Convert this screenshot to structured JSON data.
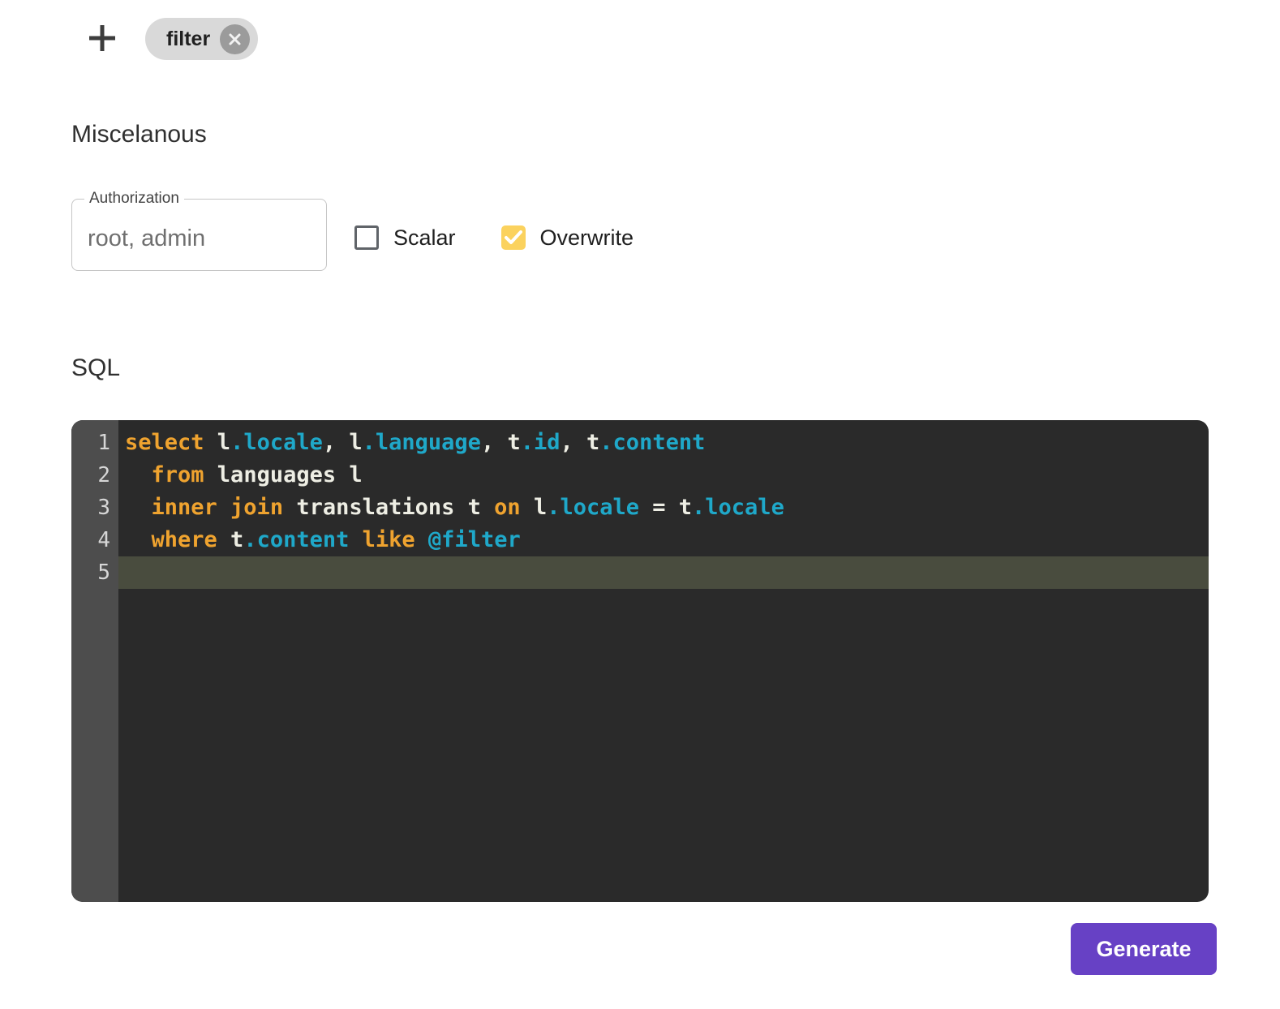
{
  "params_bar": {
    "add_icon": "plus-icon",
    "chips": [
      {
        "label": "filter"
      }
    ]
  },
  "misc_section": {
    "title": "Miscelanous",
    "authorization": {
      "label": "Authorization",
      "value": "root, admin"
    },
    "checkboxes": [
      {
        "label": "Scalar",
        "checked": false
      },
      {
        "label": "Overwrite",
        "checked": true
      }
    ]
  },
  "sql_section": {
    "title": "SQL",
    "editor": {
      "language": "sql",
      "active_line": 5,
      "lines": [
        {
          "number": 1,
          "tokens": [
            {
              "text": "select",
              "type": "keyword"
            },
            {
              "text": " l",
              "type": "plain"
            },
            {
              "text": ".locale",
              "type": "property"
            },
            {
              "text": ", l",
              "type": "plain"
            },
            {
              "text": ".language",
              "type": "property"
            },
            {
              "text": ", t",
              "type": "plain"
            },
            {
              "text": ".id",
              "type": "property"
            },
            {
              "text": ", t",
              "type": "plain"
            },
            {
              "text": ".content",
              "type": "property"
            }
          ]
        },
        {
          "number": 2,
          "tokens": [
            {
              "text": "  ",
              "type": "plain"
            },
            {
              "text": "from",
              "type": "keyword"
            },
            {
              "text": " languages l",
              "type": "plain"
            }
          ]
        },
        {
          "number": 3,
          "tokens": [
            {
              "text": "  ",
              "type": "plain"
            },
            {
              "text": "inner join",
              "type": "keyword"
            },
            {
              "text": " translations t ",
              "type": "plain"
            },
            {
              "text": "on",
              "type": "keyword"
            },
            {
              "text": " l",
              "type": "plain"
            },
            {
              "text": ".locale",
              "type": "property"
            },
            {
              "text": " = t",
              "type": "plain"
            },
            {
              "text": ".locale",
              "type": "property"
            }
          ]
        },
        {
          "number": 4,
          "tokens": [
            {
              "text": "  ",
              "type": "plain"
            },
            {
              "text": "where",
              "type": "keyword"
            },
            {
              "text": " t",
              "type": "plain"
            },
            {
              "text": ".content",
              "type": "property"
            },
            {
              "text": " ",
              "type": "plain"
            },
            {
              "text": "like",
              "type": "keyword"
            },
            {
              "text": " ",
              "type": "plain"
            },
            {
              "text": "@filter",
              "type": "property"
            }
          ]
        },
        {
          "number": 5,
          "tokens": []
        }
      ]
    }
  },
  "footer": {
    "generate_label": "Generate"
  },
  "colors": {
    "accent_purple": "#6741c5",
    "checkbox_amber": "#fbd25e",
    "chip_bg": "#d9d9d9",
    "chip_close_bg": "#9b9b9b",
    "editor_bg": "#2a2a2a",
    "gutter_bg": "#4d4d4d",
    "active_line_bg": "#494c3e",
    "code_keyword": "#efa32f",
    "code_property": "#1fa8c9",
    "code_plain": "#eeeee4"
  }
}
